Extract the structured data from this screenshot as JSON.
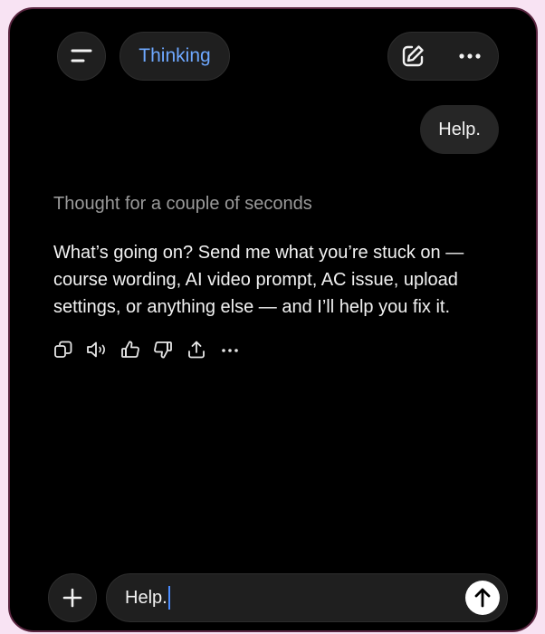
{
  "header": {
    "menu_icon": "sidebar-menu-icon",
    "mode_label": "Thinking",
    "new_chat_icon": "compose-icon",
    "more_icon": "more-horizontal-icon"
  },
  "conversation": {
    "user_message": "Help.",
    "thought_label": "Thought for a couple of seconds",
    "assistant_reply": "What’s going on? Send me what you’re stuck on — course wording, AI video prompt, AC issue, upload settings, or anything else — and I’ll help you fix it.",
    "reply_actions": [
      "copy-icon",
      "read-aloud-icon",
      "thumbs-up-icon",
      "thumbs-down-icon",
      "share-icon",
      "more-horizontal-icon"
    ]
  },
  "composer": {
    "add_icon": "plus-icon",
    "input_value": "Help.",
    "send_icon": "arrow-up-icon"
  },
  "colors": {
    "accent": "#6ea8ff",
    "background": "#000000",
    "page_background": "#f8e3f3"
  }
}
